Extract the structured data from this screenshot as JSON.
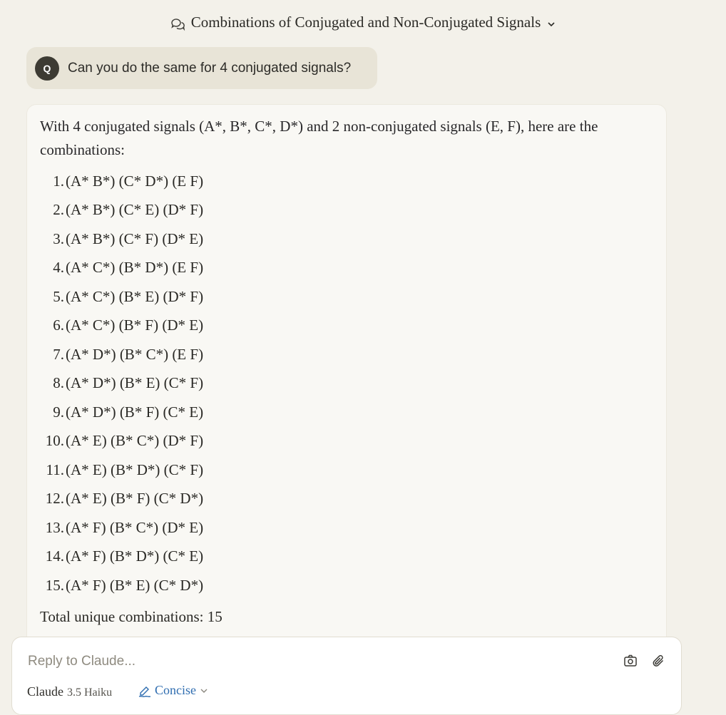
{
  "header": {
    "title": "Combinations of Conjugated and Non-Conjugated Signals"
  },
  "user_message": {
    "avatar": "Q",
    "text": "Can you do the same for 4 conjugated signals?"
  },
  "reply": {
    "intro": "With 4 conjugated signals (A*, B*, C*, D*) and 2 non-conjugated signals (E, F), here are the combinations:",
    "items": [
      {
        "num": "1.",
        "text": "(A* B*) (C* D*) (E F)"
      },
      {
        "num": "2.",
        "text": "(A* B*) (C* E) (D* F)"
      },
      {
        "num": "3.",
        "text": "(A* B*) (C* F) (D* E)"
      },
      {
        "num": "4.",
        "text": "(A* C*) (B* D*) (E F)"
      },
      {
        "num": "5.",
        "text": "(A* C*) (B* E) (D* F)"
      },
      {
        "num": "6.",
        "text": "(A* C*) (B* F) (D* E)"
      },
      {
        "num": "7.",
        "text": "(A* D*) (B* C*) (E F)"
      },
      {
        "num": "8.",
        "text": "(A* D*) (B* E) (C* F)"
      },
      {
        "num": "9.",
        "text": "(A* D*) (B* F) (C* E)"
      },
      {
        "num": "10.",
        "text": "(A* E) (B* C*) (D* F)"
      },
      {
        "num": "11.",
        "text": "(A* E) (B* D*) (C* F)"
      },
      {
        "num": "12.",
        "text": "(A* E) (B* F) (C* D*)"
      },
      {
        "num": "13.",
        "text": "(A* F) (B* C*) (D* E)"
      },
      {
        "num": "14.",
        "text": "(A* F) (B* D*) (C* E)"
      },
      {
        "num": "15.",
        "text": "(A* F) (B* E) (C* D*)"
      }
    ],
    "total": "Total unique combinations: 15"
  },
  "composer": {
    "placeholder": "Reply to Claude...",
    "model_name": "Claude",
    "model_version": "3.5 Haiku",
    "style": "Concise"
  },
  "colors": {
    "background": "#f3f1ea",
    "accent": "#2f6db0",
    "avatar": "#3d3b33"
  },
  "icons": [
    "chat-bubbles-icon",
    "chevron-down-icon",
    "camera-icon",
    "paperclip-icon",
    "pen-icon"
  ]
}
